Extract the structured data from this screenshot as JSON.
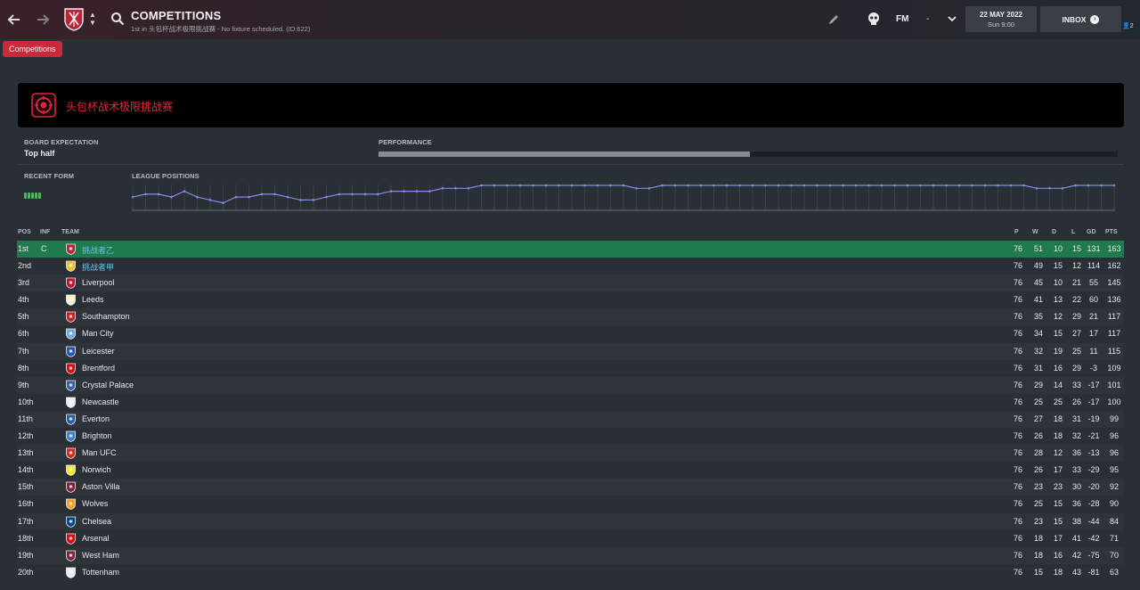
{
  "header": {
    "title": "COMPETITIONS",
    "subtitle": "1st in 头包杯战术极限挑战赛 - No fixture scheduled. (ID:622)",
    "fm_label": "FM",
    "fm_dash": "-",
    "date": "22 MAY 2022",
    "time": "Sun 9:00",
    "inbox_label": "INBOX",
    "people_count": "2"
  },
  "breadcrumb": {
    "label": "Competitions"
  },
  "competition": {
    "name": "头包杯战术极限挑战赛"
  },
  "board": {
    "label": "BOARD EXPECTATION",
    "value": "Top half"
  },
  "performance": {
    "label": "PERFORMANCE",
    "fill_fraction": 0.502
  },
  "form": {
    "label": "RECENT FORM",
    "results": [
      "W",
      "W",
      "W",
      "W",
      "W"
    ]
  },
  "positions": {
    "label": "LEAGUE POSITIONS"
  },
  "chart_data": {
    "type": "line",
    "title": "LEAGUE POSITIONS",
    "xlabel": "",
    "ylabel": "",
    "grid": true,
    "series": [
      {
        "values": [
          5,
          4,
          4,
          5,
          3,
          5,
          6,
          7,
          5,
          5,
          4,
          4,
          5,
          6,
          6,
          5,
          4,
          4,
          4,
          4,
          3,
          3,
          3,
          3,
          2,
          2,
          2,
          1,
          1,
          1,
          1,
          1,
          1,
          1,
          1,
          1,
          1,
          1,
          1,
          2,
          2,
          1,
          1,
          1,
          1,
          1,
          1,
          1,
          1,
          1,
          1,
          1,
          1,
          1,
          1,
          1,
          1,
          1,
          1,
          1,
          1,
          1,
          1,
          1,
          1,
          1,
          1,
          1,
          1,
          1,
          2,
          2,
          2,
          1,
          1,
          1,
          1
        ]
      }
    ]
  },
  "table": {
    "columns": {
      "pos": "POS",
      "inf": "INF",
      "team": "TEAM",
      "p": "P",
      "w": "W",
      "d": "D",
      "l": "L",
      "gd": "GD",
      "pts": "PTS"
    },
    "rows": [
      {
        "pos": "1st",
        "inf": "C",
        "team": "挑战者乙",
        "badge_color": "#b8243a",
        "p": "76",
        "w": "51",
        "d": "10",
        "l": "15",
        "gd": "131",
        "pts": "163"
      },
      {
        "pos": "2nd",
        "inf": "",
        "team": "挑战者甲",
        "badge_color": "#f2c21a",
        "p": "76",
        "w": "49",
        "d": "15",
        "l": "12",
        "gd": "114",
        "pts": "162"
      },
      {
        "pos": "3rd",
        "inf": "",
        "team": "Liverpool",
        "badge_color": "#c8102e",
        "p": "76",
        "w": "45",
        "d": "10",
        "l": "21",
        "gd": "55",
        "pts": "145"
      },
      {
        "pos": "4th",
        "inf": "",
        "team": "Leeds",
        "badge_color": "#f5f0c8",
        "p": "76",
        "w": "41",
        "d": "13",
        "l": "22",
        "gd": "60",
        "pts": "136"
      },
      {
        "pos": "5th",
        "inf": "",
        "team": "Southampton",
        "badge_color": "#d71920",
        "p": "76",
        "w": "35",
        "d": "12",
        "l": "29",
        "gd": "21",
        "pts": "117"
      },
      {
        "pos": "6th",
        "inf": "",
        "team": "Man City",
        "badge_color": "#6cabdd",
        "p": "76",
        "w": "34",
        "d": "15",
        "l": "27",
        "gd": "17",
        "pts": "117"
      },
      {
        "pos": "7th",
        "inf": "",
        "team": "Leicester",
        "badge_color": "#1a5bb8",
        "p": "76",
        "w": "32",
        "d": "19",
        "l": "25",
        "gd": "11",
        "pts": "115"
      },
      {
        "pos": "8th",
        "inf": "",
        "team": "Brentford",
        "badge_color": "#e30613",
        "p": "76",
        "w": "31",
        "d": "16",
        "l": "29",
        "gd": "-3",
        "pts": "109"
      },
      {
        "pos": "9th",
        "inf": "",
        "team": "Crystal Palace",
        "badge_color": "#3b5fb0",
        "p": "76",
        "w": "29",
        "d": "14",
        "l": "33",
        "gd": "-17",
        "pts": "101"
      },
      {
        "pos": "10th",
        "inf": "",
        "team": "Newcastle",
        "badge_color": "#eeeeee",
        "p": "76",
        "w": "25",
        "d": "25",
        "l": "26",
        "gd": "-17",
        "pts": "100"
      },
      {
        "pos": "11th",
        "inf": "",
        "team": "Everton",
        "badge_color": "#2a5db0",
        "p": "76",
        "w": "27",
        "d": "18",
        "l": "31",
        "gd": "-19",
        "pts": "99"
      },
      {
        "pos": "12th",
        "inf": "",
        "team": "Brighton",
        "badge_color": "#3d7fd9",
        "p": "76",
        "w": "26",
        "d": "18",
        "l": "32",
        "gd": "-21",
        "pts": "96"
      },
      {
        "pos": "13th",
        "inf": "",
        "team": "Man UFC",
        "badge_color": "#da291c",
        "p": "76",
        "w": "28",
        "d": "12",
        "l": "36",
        "gd": "-13",
        "pts": "96"
      },
      {
        "pos": "14th",
        "inf": "",
        "team": "Norwich",
        "badge_color": "#f5e626",
        "p": "76",
        "w": "26",
        "d": "17",
        "l": "33",
        "gd": "-29",
        "pts": "95"
      },
      {
        "pos": "15th",
        "inf": "",
        "team": "Aston Villa",
        "badge_color": "#8e1d3c",
        "p": "76",
        "w": "23",
        "d": "23",
        "l": "30",
        "gd": "-20",
        "pts": "92"
      },
      {
        "pos": "16th",
        "inf": "",
        "team": "Wolves",
        "badge_color": "#f9a01b",
        "p": "76",
        "w": "25",
        "d": "15",
        "l": "36",
        "gd": "-28",
        "pts": "90"
      },
      {
        "pos": "17th",
        "inf": "",
        "team": "Chelsea",
        "badge_color": "#034694",
        "p": "76",
        "w": "23",
        "d": "15",
        "l": "38",
        "gd": "-44",
        "pts": "84"
      },
      {
        "pos": "18th",
        "inf": "",
        "team": "Arsenal",
        "badge_color": "#ef0107",
        "p": "76",
        "w": "18",
        "d": "17",
        "l": "41",
        "gd": "-42",
        "pts": "71"
      },
      {
        "pos": "19th",
        "inf": "",
        "team": "West Ham",
        "badge_color": "#7a263a",
        "p": "76",
        "w": "18",
        "d": "16",
        "l": "42",
        "gd": "-75",
        "pts": "70"
      },
      {
        "pos": "20th",
        "inf": "",
        "team": "Tottenham",
        "badge_color": "#e8ebf0",
        "p": "76",
        "w": "15",
        "d": "18",
        "l": "43",
        "gd": "-81",
        "pts": "63"
      }
    ]
  },
  "colors": {
    "accent": "#c82a3b",
    "highlight_row": "#1f7a4d",
    "form_win": "#2ecc40",
    "chart_line": "#7d8ee6",
    "cn_team_text": "#67c1ee"
  }
}
